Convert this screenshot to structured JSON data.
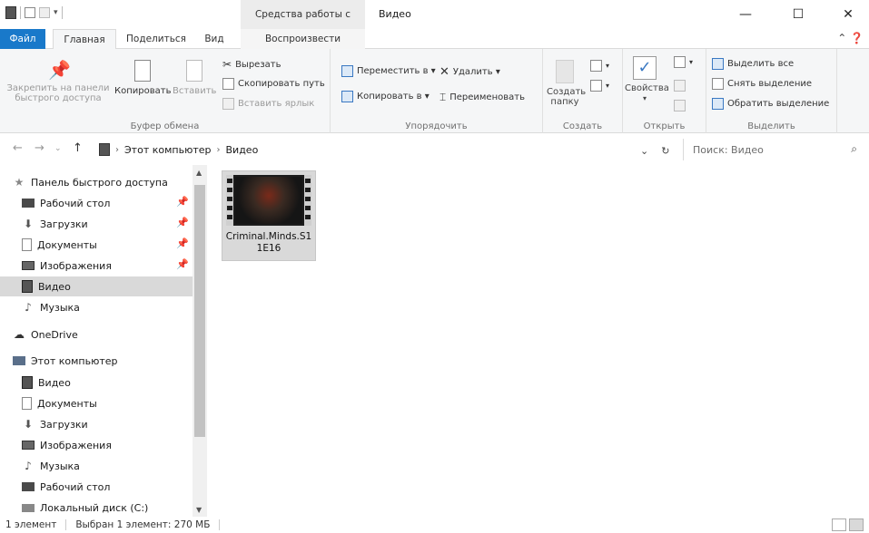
{
  "window": {
    "context_tab_label": "Средства работы с видео",
    "title": "Видео",
    "minimize": "—",
    "maximize": "☐",
    "close": "✕"
  },
  "ribbon_tabs": [
    "Файл",
    "Главная",
    "Поделиться",
    "Вид",
    "Воспроизвести"
  ],
  "ribbon": {
    "clipboard": {
      "pin_label_1": "Закрепить на панели",
      "pin_label_2": "быстрого доступа",
      "copy": "Копировать",
      "paste": "Вставить",
      "cut": "Вырезать",
      "copy_path": "Скопировать путь",
      "paste_shortcut": "Вставить ярлык",
      "group": "Буфер обмена"
    },
    "organize": {
      "move_to": "Переместить в ▾",
      "copy_to": "Копировать в ▾",
      "delete": "Удалить ▾",
      "rename": "Переименовать",
      "group": "Упорядочить"
    },
    "new": {
      "new_folder_1": "Создать",
      "new_folder_2": "папку",
      "group": "Создать"
    },
    "open": {
      "properties": "Свойства",
      "group": "Открыть"
    },
    "select": {
      "select_all": "Выделить все",
      "select_none": "Снять выделение",
      "invert": "Обратить выделение",
      "group": "Выделить"
    }
  },
  "address": {
    "crumbs": [
      "Этот компьютер",
      "Видео"
    ],
    "search_placeholder": "Поиск: Видео"
  },
  "nav": {
    "quick_access": "Панель быстрого доступа",
    "quick_items": [
      "Рабочий стол",
      "Загрузки",
      "Документы",
      "Изображения",
      "Видео",
      "Музыка"
    ],
    "onedrive": "OneDrive",
    "this_pc": "Этот компьютер",
    "pc_items": [
      "Видео",
      "Документы",
      "Загрузки",
      "Изображения",
      "Музыка",
      "Рабочий стол",
      "Локальный диск (C:)"
    ]
  },
  "files": [
    {
      "name": "Criminal.Minds.S11E16",
      "type": "video"
    }
  ],
  "status": {
    "count": "1 элемент",
    "selected": "Выбран 1 элемент: 270 МБ"
  },
  "colors": {
    "file_tab": "#1979ca",
    "selection": "#d9d9d9"
  }
}
